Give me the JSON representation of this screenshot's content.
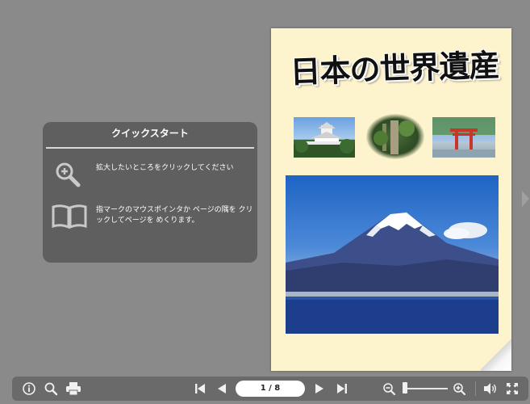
{
  "book": {
    "title": "日本の世界遺産"
  },
  "quickstart": {
    "title": "クイックスタート",
    "zoom_tip": "拡大したいところをクリックしてください",
    "page_tip": "指マークのマウスポインタか ページの隅を クリックしてページを めくります。"
  },
  "toolbar": {
    "page_indicator": "1 / 8",
    "zoom_level": 0.05
  },
  "icons": {
    "info": "info-icon",
    "search": "search-icon",
    "print": "print-icon",
    "first": "first-page-icon",
    "prev": "prev-page-icon",
    "next": "next-page-icon",
    "last": "last-page-icon",
    "zoom_out": "zoom-out-icon",
    "zoom_in": "zoom-in-icon",
    "sound": "sound-icon",
    "fullscreen": "fullscreen-icon"
  },
  "colors": {
    "background": "#8a8a8a",
    "page": "#fdf3cd",
    "panel": "#5f5f5f",
    "toolbar": "#6a6a6a"
  }
}
